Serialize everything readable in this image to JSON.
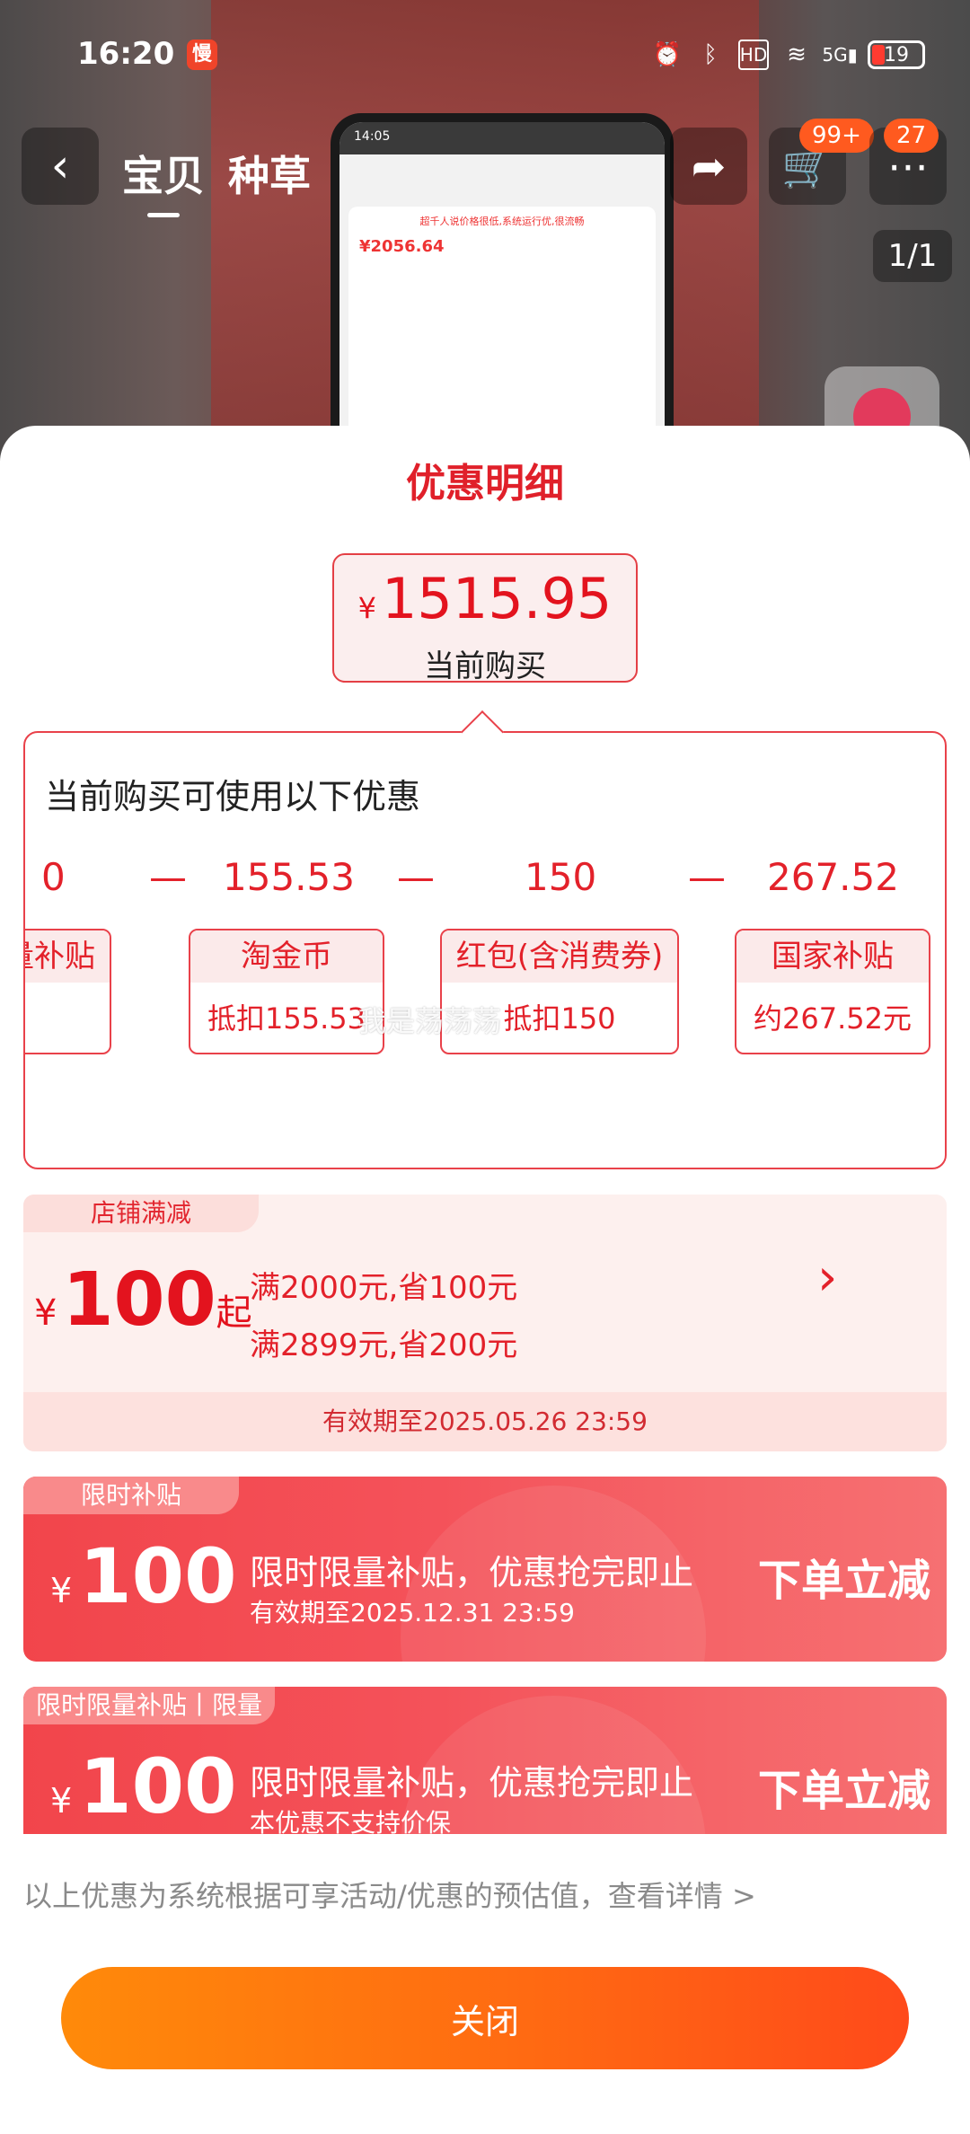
{
  "status_bar": {
    "time": "16:20",
    "app_icon_label": "慢",
    "battery": "19"
  },
  "nav": {
    "tab_baobei": "宝贝",
    "tab_zhongcao": "种草",
    "cart_badge": "99+",
    "more_badge": "27",
    "pager": "1/1"
  },
  "phone_preview": {
    "time": "14:05",
    "warning": "超千人说价格很低,系统运行优,很流畅",
    "price": "¥2056.64"
  },
  "sheet": {
    "title": "优惠明细",
    "current_price": {
      "currency": "¥",
      "amount": "1515.95",
      "label": "当前购买"
    },
    "panel_heading": "当前购买可使用以下优惠",
    "values": [
      "0",
      "—",
      "155.53",
      "—",
      "150",
      "—",
      "267.52"
    ],
    "chips": [
      {
        "title": "量补贴",
        "body": ""
      },
      {
        "title": "淘金币",
        "body": "抵扣155.53"
      },
      {
        "title": "红包(含消费券)",
        "body": "抵扣150"
      },
      {
        "title": "国家补贴",
        "body": "约267.52元"
      }
    ],
    "watermark": "我是荡荡荡",
    "store_coupon": {
      "tag": "店铺满减",
      "currency": "¥",
      "amount": "100",
      "suffix": "起",
      "rule1": "满2000元,省100元",
      "rule2": "满2899元,省200元",
      "expiry": "有效期至2025.05.26 23:59"
    },
    "subsidy1": {
      "tag": "限时补贴",
      "currency": "¥",
      "amount": "100",
      "line1": "限时限量补贴，优惠抢完即止",
      "line2": "有效期至2025.12.31 23:59",
      "action": "下单立减"
    },
    "subsidy2": {
      "tag": "限时限量补贴丨限量",
      "currency": "¥",
      "amount": "100",
      "line1": "限时限量补贴，优惠抢完即止",
      "line2": "本优惠不支持价保",
      "action": "下单立减"
    },
    "note": "以上优惠为系统根据可享活动/优惠的预估值，查看详情 >",
    "close_label": "关闭"
  },
  "colors": {
    "accent_red": "#e3131e",
    "close_orange": "#ff6a12"
  }
}
